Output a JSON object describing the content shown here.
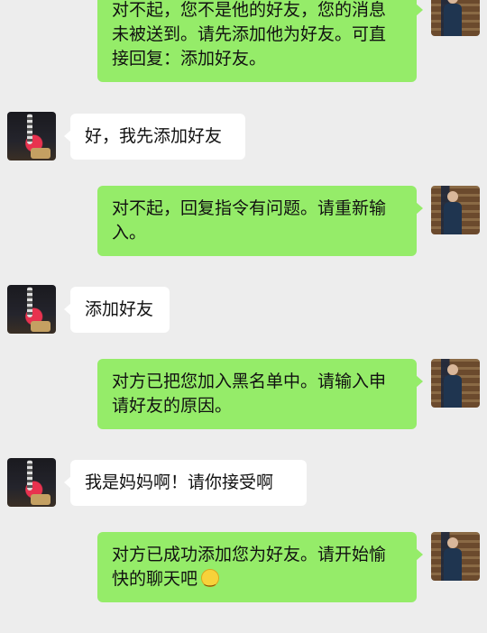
{
  "messages": [
    {
      "from": "self",
      "text": "对不起，您不是他的好友，您的消息未被送到。请先添加他为好友。可直接回复：添加好友。"
    },
    {
      "from": "other",
      "text": "好，我先添加好友"
    },
    {
      "from": "self",
      "text": "对不起，回复指令有问题。请重新输入。"
    },
    {
      "from": "other",
      "text": "添加好友"
    },
    {
      "from": "self",
      "text": "对方已把您加入黑名单中。请输入申请好友的原因。"
    },
    {
      "from": "other",
      "text": "我是妈妈啊！请你接受啊"
    },
    {
      "from": "self",
      "text": "对方已成功添加您为好友。请开始愉快的聊天吧",
      "emoji": "smile"
    }
  ],
  "colors": {
    "mine_bubble": "#95ec69",
    "theirs_bubble": "#ffffff",
    "background": "#ededed"
  }
}
